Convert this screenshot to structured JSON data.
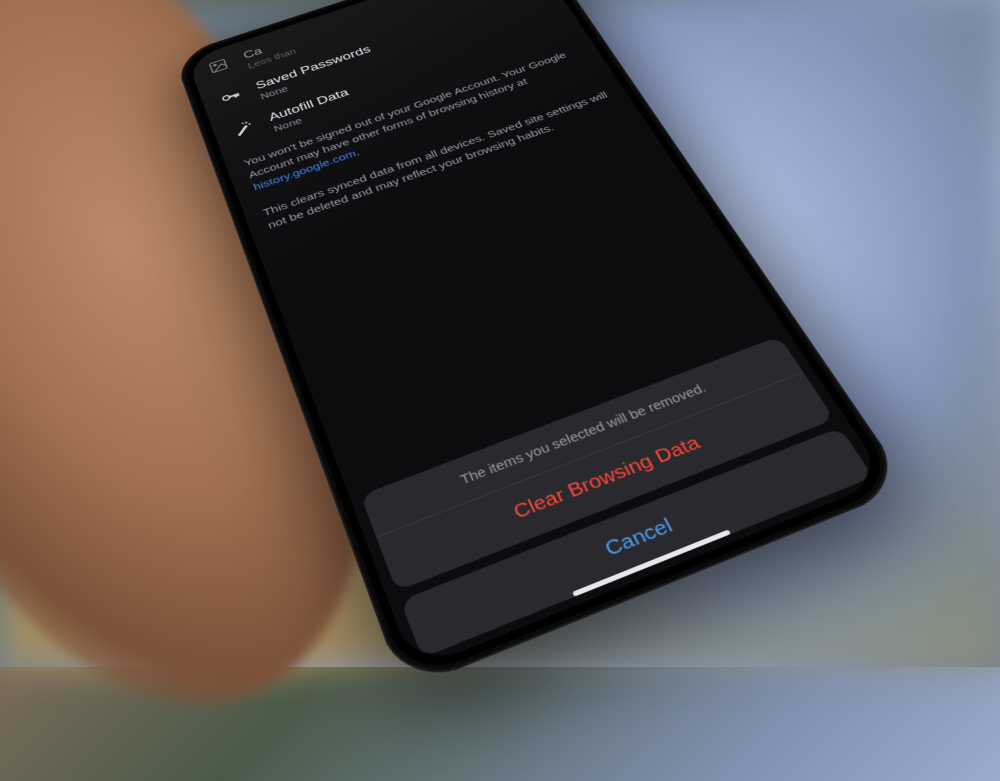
{
  "rows": {
    "cached": {
      "title": "Ca",
      "sub": "Less than"
    },
    "passwords": {
      "title": "Saved Passwords",
      "sub": "None"
    },
    "autofill": {
      "title": "Autofill Data",
      "sub": "None"
    }
  },
  "info": {
    "signout_text": "You won't be signed out of your Google Account. Your Google Account may have other forms of browsing history at ",
    "signout_link": "history.google.com",
    "signout_suffix": ".",
    "sync_text": "This clears synced data from all devices. Saved site settings will not be deleted and may reflect your browsing habits."
  },
  "sheet": {
    "header": "The items you selected will be removed.",
    "action_label": "Clear Browsing Data",
    "cancel_label": "Cancel"
  },
  "colors": {
    "destructive": "#ff453a",
    "link": "#3b82f6",
    "button_text": "#4c9ef0"
  }
}
